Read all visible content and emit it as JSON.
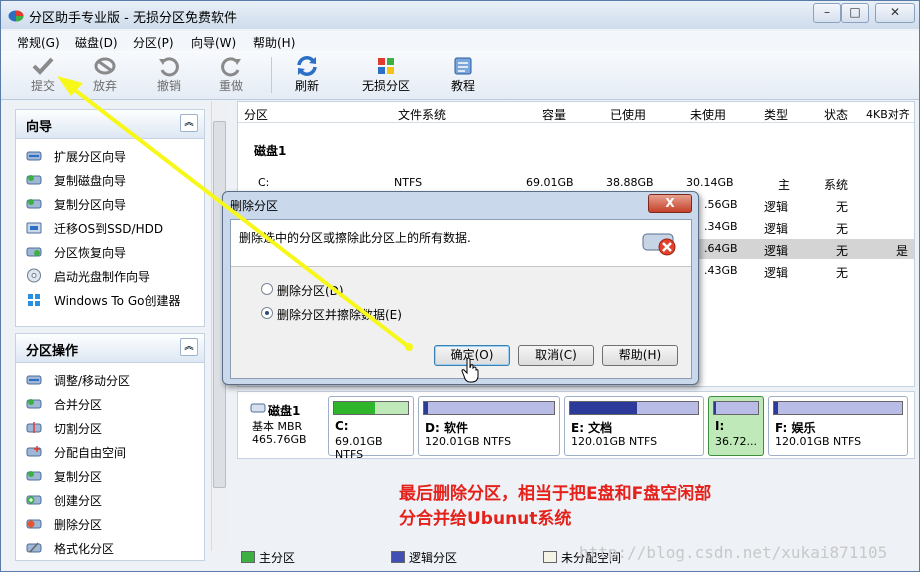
{
  "window": {
    "title": "分区助手专业版 - 无损分区免费软件"
  },
  "menu": [
    "常规(G)",
    "磁盘(D)",
    "分区(P)",
    "向导(W)",
    "帮助(H)"
  ],
  "toolbar": [
    {
      "label": "提交",
      "icon": "check-icon"
    },
    {
      "label": "放弃",
      "icon": "discard-icon"
    },
    {
      "label": "撤销",
      "icon": "undo-icon"
    },
    {
      "label": "重做",
      "icon": "redo-icon"
    },
    {
      "label": "刷新",
      "icon": "refresh-icon"
    },
    {
      "label": "无损分区",
      "icon": "windows-logo-icon"
    },
    {
      "label": "教程",
      "icon": "tutorial-icon"
    }
  ],
  "wizard_panel": {
    "title": "向导",
    "items": [
      "扩展分区向导",
      "复制磁盘向导",
      "复制分区向导",
      "迁移OS到SSD/HDD",
      "分区恢复向导",
      "启动光盘制作向导",
      "Windows To Go创建器"
    ]
  },
  "ops_panel": {
    "title": "分区操作",
    "items": [
      "调整/移动分区",
      "合并分区",
      "切割分区",
      "分配自由空间",
      "复制分区",
      "创建分区",
      "删除分区",
      "格式化分区"
    ]
  },
  "table": {
    "columns": [
      "分区",
      "文件系统",
      "容量",
      "已使用",
      "未使用",
      "类型",
      "状态",
      "4KB对齐"
    ],
    "disk_label": "磁盘1",
    "rows": [
      {
        "part": "C:",
        "fs": "NTFS",
        "cap": "69.01GB",
        "used": "38.88GB",
        "free": "30.14GB",
        "type": "主",
        "status": "系统",
        "align": ""
      },
      {
        "part": "",
        "fs": "",
        "cap": "",
        "used": "",
        "free": ".56GB",
        "type": "逻辑",
        "status": "无",
        "align": ""
      },
      {
        "part": "",
        "fs": "",
        "cap": "",
        "used": "",
        "free": ".34GB",
        "type": "逻辑",
        "status": "无",
        "align": ""
      },
      {
        "part": "",
        "fs": "",
        "cap": "",
        "used": "",
        "free": ".64GB",
        "type": "逻辑",
        "status": "无",
        "align": "是"
      },
      {
        "part": "",
        "fs": "",
        "cap": "",
        "used": "",
        "free": ".43GB",
        "type": "逻辑",
        "status": "无",
        "align": ""
      }
    ]
  },
  "disk_map": {
    "disk": {
      "name": "磁盘1",
      "kind": "基本 MBR",
      "size": "465.76GB"
    },
    "partitions": [
      {
        "name": "C:",
        "size": "69.01GB NTFS",
        "used_fraction": 0.56,
        "color": "#2fb52a"
      },
      {
        "name": "D: 软件",
        "size": "120.01GB NTFS",
        "used_fraction": 0.03,
        "color": "#2c3a9a"
      },
      {
        "name": "E: 文档",
        "size": "120.01GB NTFS",
        "used_fraction": 0.52,
        "color": "#2c3a9a"
      },
      {
        "name": "I:",
        "size": "36.72...",
        "used_fraction": 0.05,
        "color": "#2c3a9a"
      },
      {
        "name": "F: 娱乐",
        "size": "120.01GB NTFS",
        "used_fraction": 0.03,
        "color": "#2c3a9a"
      }
    ]
  },
  "legend": {
    "primary": "主分区",
    "logical": "逻辑分区",
    "unallocated": "未分配空间"
  },
  "dialog": {
    "title": "删除分区",
    "message": "删除选中的分区或擦除此分区上的所有数据.",
    "option1": "删除分区(D)",
    "option2": "删除分区并擦除数据(E)",
    "ok": "确定(O)",
    "cancel": "取消(C)",
    "help": "帮助(H)",
    "close": "X"
  },
  "annotation": {
    "line1": "最后删除分区，相当于把E盘和F盘空闲部",
    "line2": "分合并给Ubunut系统"
  },
  "watermark": "http://blog.csdn.net/xukai871105"
}
